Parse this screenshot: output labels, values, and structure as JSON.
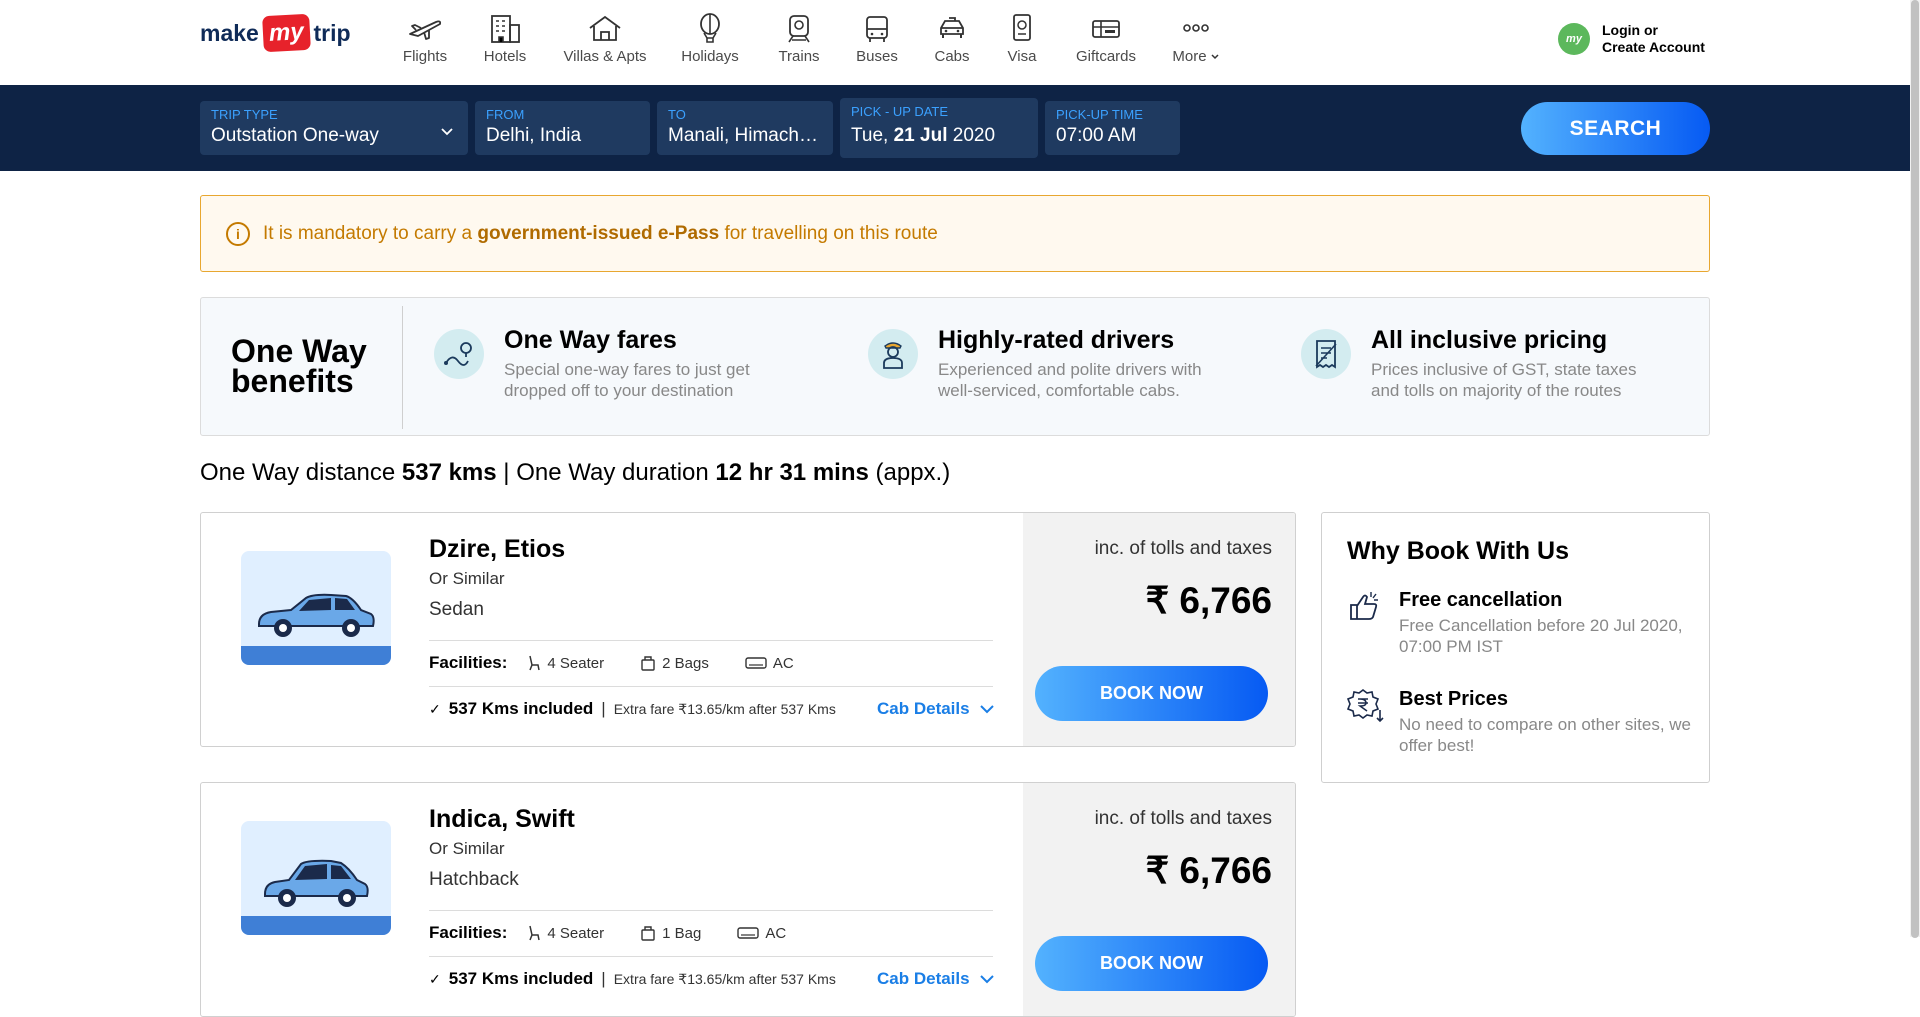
{
  "header": {
    "logo": {
      "part1": "make",
      "part2": "my",
      "part3": "trip"
    },
    "nav": [
      {
        "label": "Flights",
        "icon": "flight-icon"
      },
      {
        "label": "Hotels",
        "icon": "hotel-icon"
      },
      {
        "label": "Villas & Apts",
        "icon": "villa-icon"
      },
      {
        "label": "Holidays",
        "icon": "balloon-icon"
      },
      {
        "label": "Trains",
        "icon": "train-icon"
      },
      {
        "label": "Buses",
        "icon": "bus-icon"
      },
      {
        "label": "Cabs",
        "icon": "cab-icon"
      },
      {
        "label": "Visa",
        "icon": "passport-icon"
      },
      {
        "label": "Giftcards",
        "icon": "giftcard-icon"
      },
      {
        "label": "More",
        "icon": "more-icon"
      }
    ],
    "login": {
      "avatar": "my",
      "line1": "Login or",
      "line2": "Create Account"
    }
  },
  "search": {
    "trip_type": {
      "label": "TRIP TYPE",
      "value": "Outstation One-way"
    },
    "from": {
      "label": "FROM",
      "value": "Delhi, India"
    },
    "to": {
      "label": "TO",
      "value": "Manali, Himachal Pradesh, India"
    },
    "pickup_date": {
      "label": "PICK - UP DATE",
      "day": "Tue,",
      "date": "21 Jul",
      "year": "2020"
    },
    "pickup_time": {
      "label": "PICK-UP TIME",
      "value": "07:00 AM"
    },
    "button": "SEARCH"
  },
  "alert": {
    "pre": "It is mandatory to carry a",
    "bold": "government-issued e-Pass",
    "post": "for travelling on this route"
  },
  "benefits": {
    "title_line1": "One Way",
    "title_line2": "benefits",
    "items": [
      {
        "title": "One Way fares",
        "desc": "Special one-way fares to just get dropped off to your destination"
      },
      {
        "title": "Highly-rated drivers",
        "desc": "Experienced and polite drivers with well-serviced, comfortable cabs."
      },
      {
        "title": "All inclusive pricing",
        "desc": "Prices inclusive of GST, state taxes and tolls on majority of the routes"
      }
    ]
  },
  "distance": {
    "label1": "One Way distance",
    "distance": "537 kms",
    "sep": "|",
    "label2": "One Way duration",
    "duration": "12 hr 31 mins",
    "suffix": "(appx.)"
  },
  "cabs": [
    {
      "name": "Dzire, Etios",
      "similar": "Or Similar",
      "type": "Sedan",
      "facilities_label": "Facilities:",
      "seats": "4 Seater",
      "bags": "2 Bags",
      "ac": "AC",
      "kms_included": "537 Kms included",
      "extra_fare": "Extra fare ₹13.65/km after 537 Kms",
      "details": "Cab Details",
      "incl": "inc. of tolls and taxes",
      "price": "₹ 6,766",
      "book": "BOOK NOW"
    },
    {
      "name": "Indica, Swift",
      "similar": "Or Similar",
      "type": "Hatchback",
      "facilities_label": "Facilities:",
      "seats": "4 Seater",
      "bags": "1 Bag",
      "ac": "AC",
      "kms_included": "537 Kms included",
      "extra_fare": "Extra fare ₹13.65/km after 537 Kms",
      "details": "Cab Details",
      "incl": "inc. of tolls and taxes",
      "price": "₹ 6,766",
      "book": "BOOK NOW"
    }
  ],
  "why": {
    "title": "Why Book With Us",
    "items": [
      {
        "title": "Free cancellation",
        "desc": "Free Cancellation before 20 Jul 2020, 07:00 PM IST"
      },
      {
        "title": "Best Prices",
        "desc": "No need to compare on other sites, we offer best!"
      }
    ]
  },
  "colors": {
    "navy": "#0e2345",
    "accent_blue": "#3ba1ff",
    "brand_red": "#e7222b",
    "alert_orange": "#c47a00"
  }
}
